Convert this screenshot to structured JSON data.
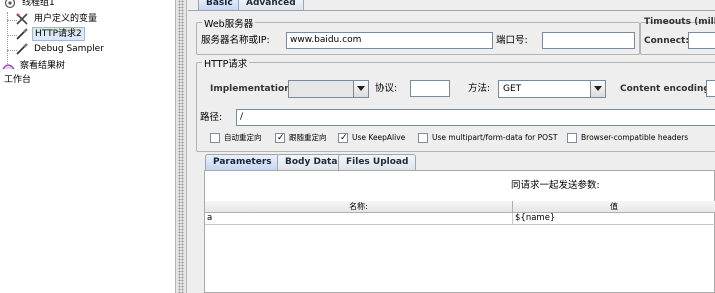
{
  "tree": {
    "items": [
      {
        "label": "线程组1",
        "icon": "thread-group-icon"
      },
      {
        "label": "用户定义的变量",
        "icon": "tools-icon"
      },
      {
        "label": "HTTP请求2",
        "icon": "pipette-icon",
        "selected": true
      },
      {
        "label": "Debug Sampler",
        "icon": "pipette-icon"
      },
      {
        "label": "察看结果树",
        "icon": "listener-icon"
      },
      {
        "label": "工作台",
        "icon": ""
      }
    ]
  },
  "tabs": {
    "basic": "Basic",
    "advanced": "Advanced"
  },
  "web_server": {
    "title": "Web服务器",
    "server_label": "服务器名称或IP:",
    "server_value": "www.baidu.com",
    "port_label": "端口号:",
    "port_value": ""
  },
  "timeouts": {
    "title": "Timeouts (milli",
    "connect_label": "Connect:",
    "connect_value": ""
  },
  "http_request": {
    "title": "HTTP请求",
    "implementation_label": "Implementation:",
    "implementation_value": "",
    "protocol_label": "协议:",
    "protocol_value": "",
    "method_label": "方法:",
    "method_value": "GET",
    "encoding_label": "Content encoding:",
    "path_label": "路径:",
    "path_value": "/"
  },
  "options": [
    {
      "label": "自动重定向",
      "checked": false
    },
    {
      "label": "跟随重定向",
      "checked": true
    },
    {
      "label": "Use KeepAlive",
      "checked": true
    },
    {
      "label": "Use multipart/form-data for POST",
      "checked": false
    },
    {
      "label": "Browser-compatible headers",
      "checked": false
    }
  ],
  "subtabs": {
    "parameters": "Parameters",
    "body": "Body Data",
    "files": "Files Upload"
  },
  "params_table": {
    "caption": "同请求一起发送参数:",
    "columns": [
      "名称:",
      "值"
    ],
    "rows": [
      {
        "name": "a",
        "value": "${name}"
      }
    ]
  }
}
